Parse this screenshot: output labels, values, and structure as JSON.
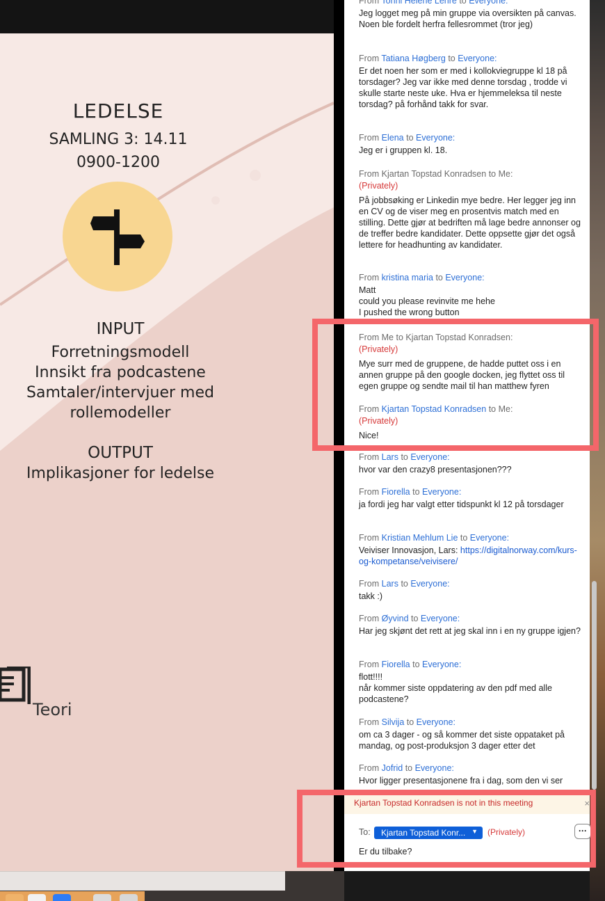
{
  "slide": {
    "title": "LEDELSE",
    "session": "SAMLING 3: 14.11",
    "time": "0900-1200",
    "input_heading": "INPUT",
    "input_lines": [
      "Forretningsmodell",
      "Innsikt fra podcastene",
      "Samtaler/intervjuer med",
      "rollemodeller"
    ],
    "output_heading": "OUTPUT",
    "output_line": "Implikasjoner for ledelse",
    "teori_label": "Teori"
  },
  "chat": {
    "messages": [
      {
        "from": "Tonni Helene Lehre",
        "to": "Everyone:",
        "private": "",
        "body": "Jeg logget meg på min gruppe via oversikten på canvas. Noen ble fordelt herfra fellesrommet (tror jeg)"
      },
      {
        "from": "Tatiana Høgberg",
        "to": "Everyone:",
        "private": "",
        "body": "Er det noen her som er med i kollokviegruppe kl 18 på torsdager? Jeg var ikke med denne torsdag  , trodde vi skulle starte neste uke.  Hva er hjemmeleksa til neste torsdag? på forhånd takk for svar."
      },
      {
        "from": "Elena",
        "to": "Everyone:",
        "private": "",
        "body": "Jeg er i gruppen kl. 18."
      },
      {
        "from": "Kjartan Topstad Konradsen",
        "to": "Me:",
        "private": "(Privately)",
        "body": "På jobbsøking er Linkedin mye bedre. Her legger jeg inn en CV og de viser meg en prosentvis match med en stilling. Dette gjør at bedriften må lage bedre annonser og de treffer bedre kandidater. Dette oppsette gjør det også lettere for headhunting av kandidater."
      },
      {
        "from": "kristina maria",
        "to": "Everyone:",
        "private": "",
        "body": "Matt\ncould you please revinvite me hehe\nI pushed the wrong button"
      },
      {
        "from": "Me",
        "to": "Kjartan Topstad Konradsen:",
        "private": "(Privately)",
        "body": "Mye surr med de gruppene, de hadde puttet oss i en annen gruppe på den google docken, jeg flyttet oss til egen gruppe og sendte mail til han matthew fyren"
      },
      {
        "from": "Kjartan Topstad Konradsen",
        "to": "Me:",
        "private": "(Privately)",
        "body": "Nice!"
      },
      {
        "from": "Lars",
        "to": "Everyone:",
        "private": "",
        "body": "hvor var den crazy8 presentasjonen???"
      },
      {
        "from": "Fiorella",
        "to": "Everyone:",
        "private": "",
        "body": "ja fordi jeg har valgt etter tidspunkt kl 12 på torsdager"
      },
      {
        "from": "Kristian Mehlum Lie",
        "to": "Everyone:",
        "private": "",
        "body": "Veiviser Innovasjon, Lars: ",
        "link": "https://digitalnorway.com/kurs-og-kompetanse/veivisere/"
      },
      {
        "from": "Lars",
        "to": "Everyone:",
        "private": "",
        "body": "takk :)"
      },
      {
        "from": "Øyvind",
        "to": "Everyone:",
        "private": "",
        "body": "Har jeg skjønt det rett at jeg skal inn i en ny gruppe igjen?"
      },
      {
        "from": "Fiorella",
        "to": "Everyone:",
        "private": "",
        "body": "flott!!!!\nnår kommer siste oppdatering av den pdf med alle podcastene?"
      },
      {
        "from": "Silvija",
        "to": "Everyone:",
        "private": "",
        "body": "om ca 3 dager - og så kommer det siste oppataket på mandag, og post-produksjon 3 dager etter det"
      },
      {
        "from": "Jofrid",
        "to": "Everyone:",
        "private": "",
        "body": "Hvor ligger presentasjonene fra i dag, som den vi ser"
      }
    ],
    "from_word": "From",
    "to_word": "to",
    "notice": "Kjartan Topstad Konradsen is not in this meeting",
    "notice_close": "×",
    "compose": {
      "to_label": "To:",
      "recipient": "Kjartan Topstad Konr...",
      "privately": "(Privately)",
      "more": "···",
      "input_value": "Er du tilbake?"
    }
  },
  "colors": {
    "highlight": "#f4666a",
    "link_blue": "#2d6fd6",
    "private_red": "#d63a3a",
    "slide_bg": "#f7e9e5",
    "circle": "#f8d691"
  }
}
